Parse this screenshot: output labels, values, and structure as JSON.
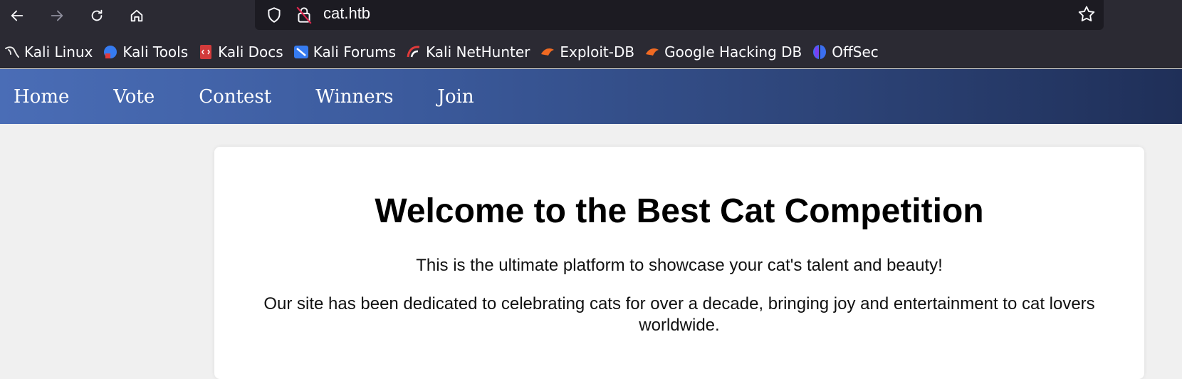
{
  "browser": {
    "url": "cat.htb",
    "icons": {
      "back": "arrow-left-icon",
      "forward": "arrow-right-icon",
      "reload": "reload-icon",
      "home": "home-icon",
      "tracking": "shield-icon",
      "insecure": "lock-slash-icon",
      "bookmark_star": "star-icon"
    },
    "colors": {
      "toolbar": "#2b2a33",
      "urlbar": "#1c1b22"
    }
  },
  "bookmarks": [
    {
      "label": "Kali Linux",
      "icon": "kali-dragon-icon"
    },
    {
      "label": "Kali Tools",
      "icon": "kali-tools-icon"
    },
    {
      "label": "Kali Docs",
      "icon": "kali-docs-icon"
    },
    {
      "label": "Kali Forums",
      "icon": "kali-forums-icon"
    },
    {
      "label": "Kali NetHunter",
      "icon": "kali-nethunter-icon"
    },
    {
      "label": "Exploit-DB",
      "icon": "exploit-db-icon"
    },
    {
      "label": "Google Hacking DB",
      "icon": "ghdb-icon"
    },
    {
      "label": "OffSec",
      "icon": "offsec-icon"
    }
  ],
  "site": {
    "nav": [
      "Home",
      "Vote",
      "Contest",
      "Winners",
      "Join"
    ],
    "heading": "Welcome to the Best Cat Competition",
    "paragraph1": "This is the ultimate platform to showcase your cat's talent and beauty!",
    "paragraph2": "Our site has been dedicated to celebrating cats for over a decade, bringing joy and entertainment to cat lovers worldwide.",
    "colors": {
      "nav_start": "#4a6db6",
      "nav_end": "#1f2f58",
      "background": "#f0f0f0"
    }
  }
}
